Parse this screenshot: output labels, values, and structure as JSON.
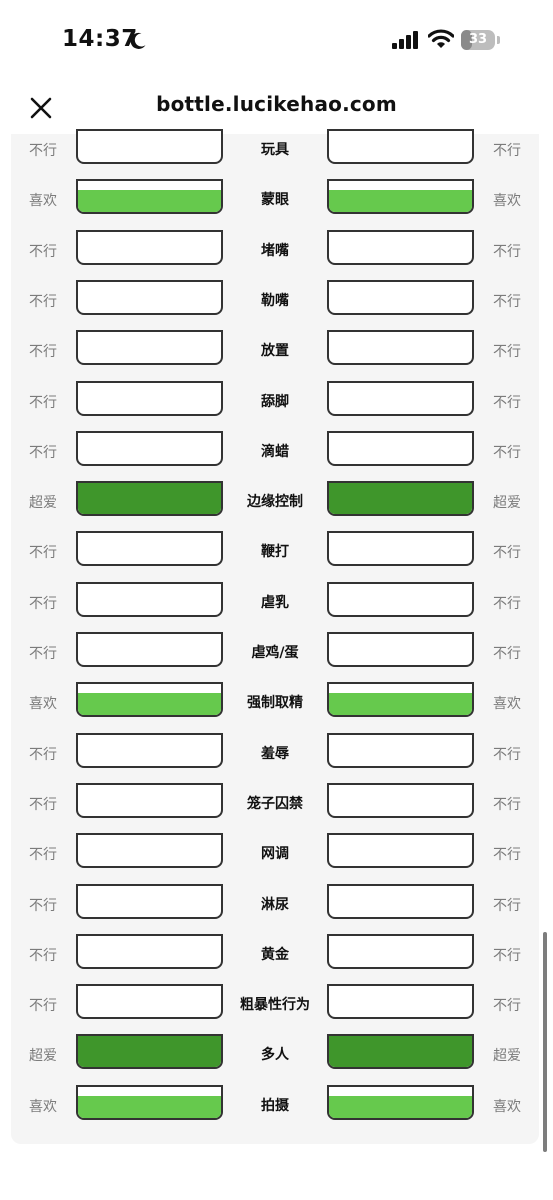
{
  "status_bar": {
    "time": "14:37",
    "battery": "33",
    "battery_level": 0.33,
    "icons": [
      "moon-icon",
      "signal-icon",
      "wifi-icon",
      "battery-icon"
    ]
  },
  "browser": {
    "url": "bottle.lucikehao.com",
    "close_icon": "close-icon"
  },
  "levels": {
    "不行": {
      "fill": 0,
      "color": "#ffffff"
    },
    "喜欢": {
      "fill": 0.7,
      "color": "#66c94d"
    },
    "超爱": {
      "fill": 1.0,
      "color": "#3f962b"
    }
  },
  "rows": [
    {
      "label": "玩具",
      "left": "不行",
      "right": "不行"
    },
    {
      "label": "蒙眼",
      "left": "喜欢",
      "right": "喜欢"
    },
    {
      "label": "堵嘴",
      "left": "不行",
      "right": "不行"
    },
    {
      "label": "勒嘴",
      "left": "不行",
      "right": "不行"
    },
    {
      "label": "放置",
      "left": "不行",
      "right": "不行"
    },
    {
      "label": "舔脚",
      "left": "不行",
      "right": "不行"
    },
    {
      "label": "滴蜡",
      "left": "不行",
      "right": "不行"
    },
    {
      "label": "边缘控制",
      "left": "超爱",
      "right": "超爱"
    },
    {
      "label": "鞭打",
      "left": "不行",
      "right": "不行"
    },
    {
      "label": "虐乳",
      "left": "不行",
      "right": "不行"
    },
    {
      "label": "虐鸡/蛋",
      "left": "不行",
      "right": "不行"
    },
    {
      "label": "强制取精",
      "left": "喜欢",
      "right": "喜欢"
    },
    {
      "label": "羞辱",
      "left": "不行",
      "right": "不行"
    },
    {
      "label": "笼子囚禁",
      "left": "不行",
      "right": "不行"
    },
    {
      "label": "网调",
      "left": "不行",
      "right": "不行"
    },
    {
      "label": "淋尿",
      "left": "不行",
      "right": "不行"
    },
    {
      "label": "黄金",
      "left": "不行",
      "right": "不行"
    },
    {
      "label": "粗暴性行为",
      "left": "不行",
      "right": "不行"
    },
    {
      "label": "多人",
      "left": "超爱",
      "right": "超爱"
    },
    {
      "label": "拍摄",
      "left": "喜欢",
      "right": "喜欢"
    }
  ]
}
